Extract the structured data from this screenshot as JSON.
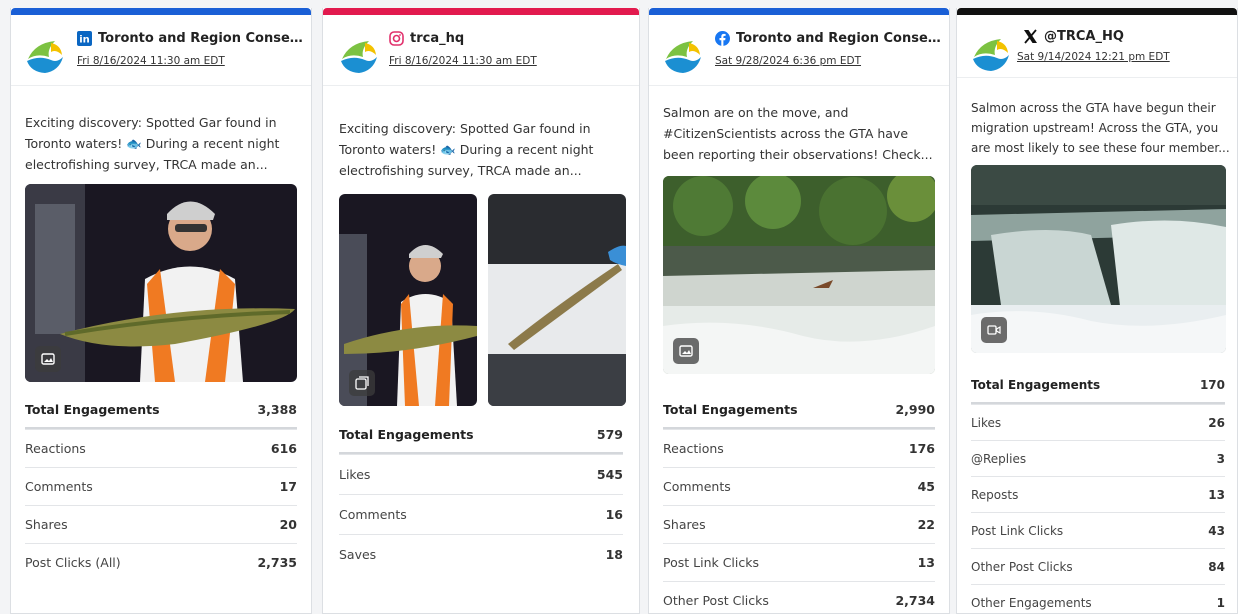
{
  "cards": [
    {
      "network": "linkedin",
      "accent": "#1a5fd6",
      "account": "Toronto and Region Conse...",
      "date": "Fri 8/16/2024 11:30 am EDT",
      "text_lines": [
        "Exciting discovery: Spotted Gar found in",
        "Toronto waters! 🐟 During a recent night",
        "electrofishing survey, TRCA made an..."
      ],
      "media_icon": "image-icon",
      "metrics": [
        {
          "label": "Total Engagements",
          "value": "3,388"
        },
        {
          "label": "Reactions",
          "value": "616"
        },
        {
          "label": "Comments",
          "value": "17"
        },
        {
          "label": "Shares",
          "value": "20"
        },
        {
          "label": "Post Clicks (All)",
          "value": "2,735"
        }
      ]
    },
    {
      "network": "instagram",
      "accent": "#e21a4e",
      "account": "trca_hq",
      "date": "Fri 8/16/2024 11:30 am EDT",
      "text_lines": [
        "Exciting discovery: Spotted Gar found in",
        "Toronto waters! 🐟 During a recent night",
        "electrofishing survey, TRCA made an..."
      ],
      "media_icon": "carousel-icon",
      "metrics": [
        {
          "label": "Total Engagements",
          "value": "579"
        },
        {
          "label": "Likes",
          "value": "545"
        },
        {
          "label": "Comments",
          "value": "16"
        },
        {
          "label": "Saves",
          "value": "18"
        }
      ]
    },
    {
      "network": "facebook",
      "accent": "#1a5fd6",
      "account": "Toronto and Region Conse...",
      "date": "Sat 9/28/2024 6:36 pm EDT",
      "text_lines": [
        "Salmon are on the move, and",
        "#CitizenScientists across the GTA have",
        "been reporting their observations! Check..."
      ],
      "media_icon": "image-icon",
      "metrics": [
        {
          "label": "Total Engagements",
          "value": "2,990"
        },
        {
          "label": "Reactions",
          "value": "176"
        },
        {
          "label": "Comments",
          "value": "45"
        },
        {
          "label": "Shares",
          "value": "22"
        },
        {
          "label": "Post Link Clicks",
          "value": "13"
        },
        {
          "label": "Other Post Clicks",
          "value": "2,734"
        }
      ]
    },
    {
      "network": "x",
      "accent": "#111111",
      "account": "@TRCA_HQ",
      "date": "Sat 9/14/2024 12:21 pm EDT",
      "text_lines": [
        "Salmon across the GTA have begun their",
        "migration upstream! Across the GTA, you",
        "are most likely to see these four member..."
      ],
      "media_icon": "video-icon",
      "metrics": [
        {
          "label": "Total Engagements",
          "value": "170"
        },
        {
          "label": "Likes",
          "value": "26"
        },
        {
          "label": "@Replies",
          "value": "3"
        },
        {
          "label": "Reposts",
          "value": "13"
        },
        {
          "label": "Post Link Clicks",
          "value": "43"
        },
        {
          "label": "Other Post Clicks",
          "value": "84"
        },
        {
          "label": "Other Engagements",
          "value": "1"
        }
      ]
    }
  ]
}
